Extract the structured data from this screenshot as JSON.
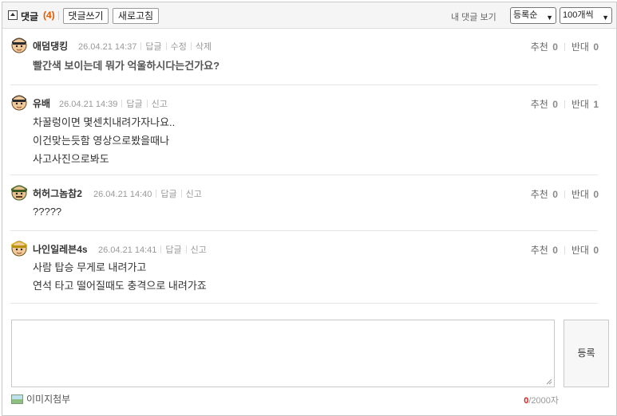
{
  "header": {
    "title": "댓글",
    "count": "(4)",
    "write_label": "댓글쓰기",
    "refresh_label": "새로고침",
    "my_comments_label": "내 댓글 보기",
    "sort_selected": "등록순",
    "page_size_selected": "100개씩"
  },
  "comments": [
    {
      "nick": "애덤댕킹",
      "date": "26.04.21 14:37",
      "actions": [
        "답글",
        "수정",
        "삭제"
      ],
      "lines": [
        "빨간색 보이는데 뭐가 억울하시다는건가요?"
      ],
      "up_label": "추천",
      "up": "0",
      "down_label": "반대",
      "down": "0"
    },
    {
      "nick": "유배",
      "date": "26.04.21 14:39",
      "actions": [
        "답글",
        "신고"
      ],
      "lines": [
        "차꿀렁이면 몇센치내려가자나요..",
        "이건맞는듯함 영상으로봤을때나",
        "사고사진으로봐도"
      ],
      "up_label": "추천",
      "up": "0",
      "down_label": "반대",
      "down": "1"
    },
    {
      "nick": "허허그놈참2",
      "date": "26.04.21 14:40",
      "actions": [
        "답글",
        "신고"
      ],
      "lines": [
        "?????"
      ],
      "up_label": "추천",
      "up": "0",
      "down_label": "반대",
      "down": "0"
    },
    {
      "nick": "나인일레븐4s",
      "date": "26.04.21 14:41",
      "actions": [
        "답글",
        "신고"
      ],
      "lines": [
        "사람 탑승 무게로 내려가고",
        "연석 타고 떨어질때도 충격으로 내려가죠"
      ],
      "up_label": "추천",
      "up": "0",
      "down_label": "반대",
      "down": "0"
    }
  ],
  "composer": {
    "value": "",
    "submit_label": "등록",
    "attach_label": "이미지첨부",
    "char_count": "0",
    "char_limit": "/2000자"
  }
}
